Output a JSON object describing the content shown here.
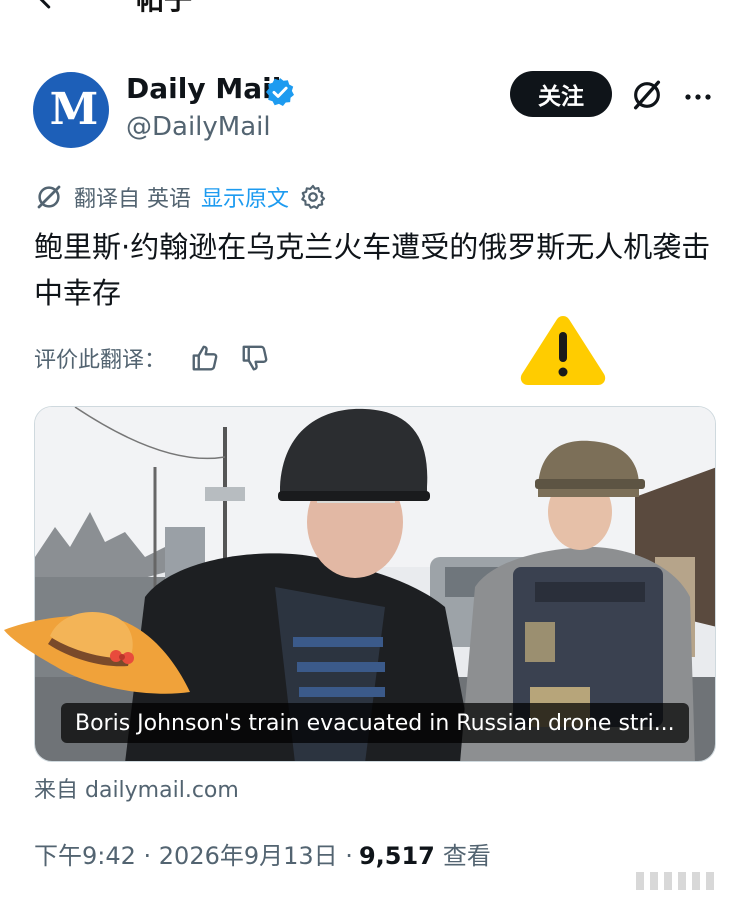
{
  "header": {
    "title": "帖子",
    "back_icon": "arrow-left-icon"
  },
  "author": {
    "avatar_letters": "M",
    "display_name": "Daily Mail",
    "handle": "@DailyMail",
    "verified_color": "#1d9bf0",
    "avatar_color": "#1d5fb8",
    "follow_label": "关注",
    "grok_icon": "grok-icon",
    "more_icon": "more-horizontal-icon"
  },
  "translation": {
    "label": "翻译自 英语",
    "show_original": "显示原文",
    "rate_label": "评价此翻译：",
    "link_color": "#1d9bf0"
  },
  "tweet": {
    "text": "鲍里斯·约翰逊在乌克兰火车遭受的俄罗斯无人机袭击中幸存"
  },
  "media": {
    "caption": "Boris Johnson's train evacuated in Russian drone stri..."
  },
  "source": {
    "text": "来自 dailymail.com"
  },
  "meta": {
    "time_date": "下午9:42 · 2026年9月13日 · ",
    "views": "9,517",
    "views_label": "查看"
  },
  "stickers": {
    "warning_color": "#ffcc00",
    "hat_color": "#f0a23a"
  }
}
